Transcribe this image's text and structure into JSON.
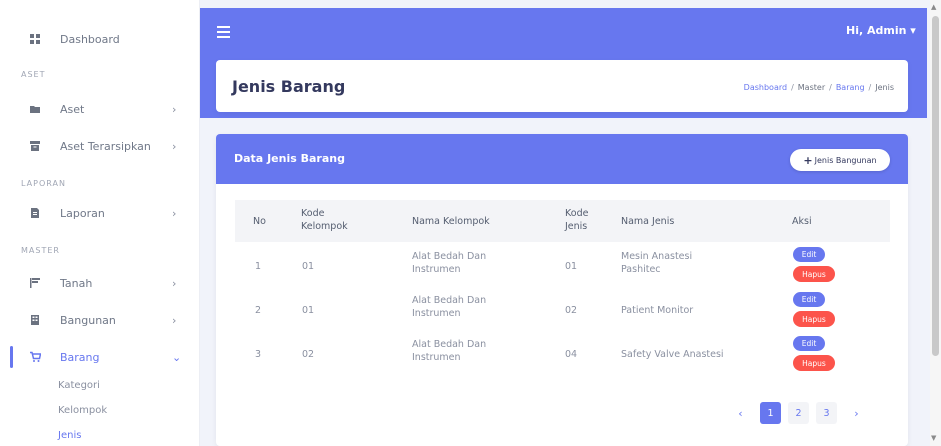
{
  "sidebar": {
    "sections": {
      "aset": "ASET",
      "laporan": "LAPORAN",
      "master": "MASTER"
    },
    "items": {
      "dashboard": "Dashboard",
      "aset": "Aset",
      "aset_terarsipkan": "Aset Terarsipkan",
      "laporan": "Laporan",
      "tanah": "Tanah",
      "bangunan": "Bangunan",
      "barang": "Barang"
    },
    "chevron": "›",
    "chevron_down": "⌄",
    "sub_items": {
      "kategori": "Kategori",
      "kelompok": "Kelompok",
      "jenis": "Jenis"
    }
  },
  "topbar": {
    "user_greeting": "Hi, Admin ▾"
  },
  "header": {
    "title": "Jenis Barang",
    "breadcrumb": {
      "dashboard": "Dashboard",
      "master": "Master",
      "barang": "Barang",
      "current": "Jenis",
      "separator": "/"
    }
  },
  "card": {
    "title": "Data Jenis Barang",
    "add_plus": "+",
    "add_button": "Jenis Bangunan"
  },
  "table": {
    "headers": {
      "no": "No",
      "kode_kelompok_1": "Kode",
      "kode_kelompok_2": "Kelompok",
      "nama_kelompok": "Nama Kelompok",
      "kode_jenis_1": "Kode",
      "kode_jenis_2": "Jenis",
      "nama_jenis": "Nama Jenis",
      "aksi": "Aksi"
    },
    "rows": [
      {
        "no": "1",
        "kode_kelompok": "01",
        "nama_kelompok_1": "Alat Bedah Dan",
        "nama_kelompok_2": "Instrumen",
        "kode_jenis": "01",
        "nama_jenis_1": "Mesin Anastesi",
        "nama_jenis_2": "Pashitec",
        "edit": "Edit",
        "hapus": "Hapus"
      },
      {
        "no": "2",
        "kode_kelompok": "01",
        "nama_kelompok_1": "Alat Bedah Dan",
        "nama_kelompok_2": "Instrumen",
        "kode_jenis": "02",
        "nama_jenis_1": "Patient Monitor",
        "nama_jenis_2": "",
        "edit": "Edit",
        "hapus": "Hapus"
      },
      {
        "no": "3",
        "kode_kelompok": "02",
        "nama_kelompok_1": "Alat Bedah Dan",
        "nama_kelompok_2": "Instrumen",
        "kode_jenis": "04",
        "nama_jenis_1": "Safety Valve Anastesi",
        "nama_jenis_2": "",
        "edit": "Edit",
        "hapus": "Hapus"
      }
    ]
  },
  "pagination": {
    "prev": "‹",
    "pages": [
      "1",
      "2",
      "3"
    ],
    "next": "›",
    "active_page": "1"
  },
  "colors": {
    "primary": "#6777ef",
    "danger": "#fc544b",
    "background": "#f1f3fa"
  },
  "icons": {
    "menu": "hamburger-icon",
    "dashboard": "grid-icon",
    "aset": "folder-icon",
    "aset_terarsipkan": "archive-icon",
    "laporan": "file-icon",
    "tanah": "flag-icon",
    "bangunan": "building-icon",
    "barang": "cart-icon"
  }
}
